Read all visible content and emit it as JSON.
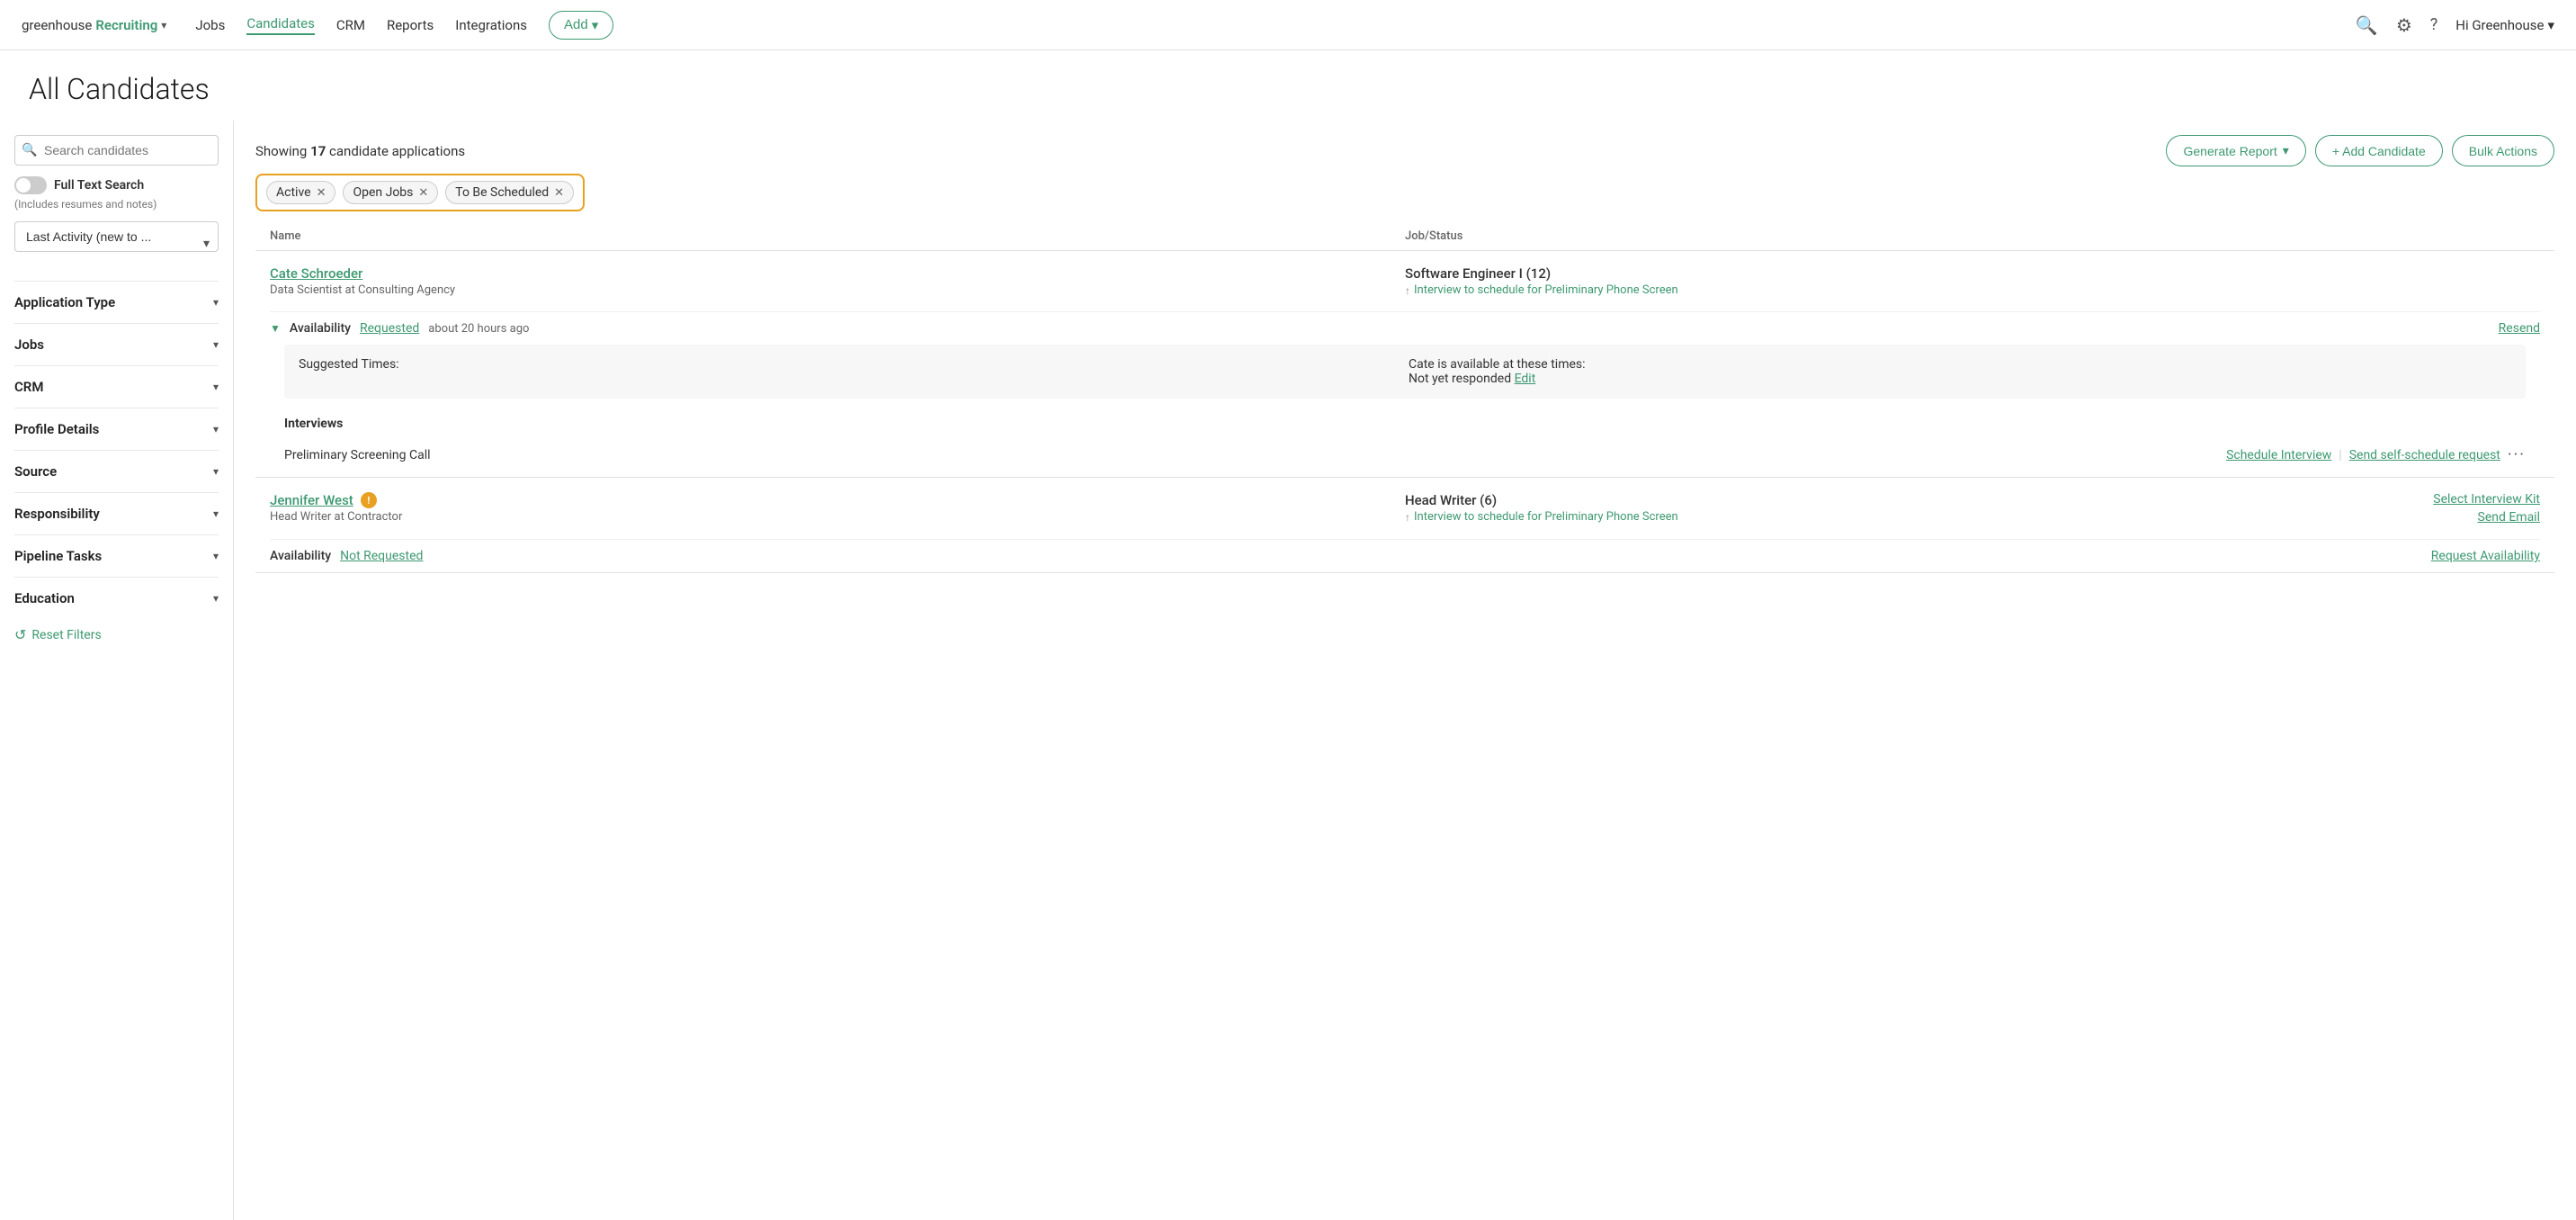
{
  "nav": {
    "logo_text": "greenhouse",
    "logo_green": "Recruiting",
    "links": [
      "Jobs",
      "Candidates",
      "CRM",
      "Reports",
      "Integrations"
    ],
    "active_link": "Candidates",
    "add_button": "Add",
    "user_text": "Hi Greenhouse"
  },
  "page": {
    "title": "All Candidates"
  },
  "sidebar": {
    "search_placeholder": "Search candidates",
    "full_text_label": "Full Text Search",
    "full_text_sub": "(Includes resumes and notes)",
    "sort_option": "Last Activity (new to ...",
    "filters": [
      {
        "id": "application-type",
        "label": "Application Type"
      },
      {
        "id": "jobs",
        "label": "Jobs"
      },
      {
        "id": "crm",
        "label": "CRM"
      },
      {
        "id": "profile-details",
        "label": "Profile Details"
      },
      {
        "id": "source",
        "label": "Source"
      },
      {
        "id": "responsibility",
        "label": "Responsibility"
      },
      {
        "id": "pipeline-tasks",
        "label": "Pipeline Tasks"
      },
      {
        "id": "education",
        "label": "Education"
      }
    ],
    "reset_filters": "Reset Filters"
  },
  "content": {
    "showing_label": "Showing",
    "showing_count": "17",
    "showing_suffix": "candidate applications",
    "generate_report": "Generate Report",
    "add_candidate": "+ Add Candidate",
    "bulk_actions": "Bulk Actions"
  },
  "filter_tags": [
    {
      "label": "Active",
      "id": "active"
    },
    {
      "label": "Open Jobs",
      "id": "open-jobs"
    },
    {
      "label": "To Be Scheduled",
      "id": "to-be-scheduled"
    }
  ],
  "table": {
    "col_name": "Name",
    "col_job_status": "Job/Status"
  },
  "candidates": [
    {
      "id": "cate-schroeder",
      "name": "Cate Schroeder",
      "subtitle": "Data Scientist at Consulting Agency",
      "job_title": "Software Engineer I (12)",
      "job_status": "Interview to schedule for Preliminary Phone Screen",
      "has_warning": false,
      "availability": {
        "label": "Availability",
        "status": "Requested",
        "time_ago": "about 20 hours ago",
        "resend": "Resend",
        "suggested_times_label": "Suggested Times:",
        "suggested_value_line1": "Cate is available at these times:",
        "suggested_value_line2": "Not yet responded",
        "edit_link": "Edit"
      },
      "interviews_title": "Interviews",
      "interviews": [
        {
          "name": "Preliminary Screening Call",
          "action1": "Schedule Interview",
          "sep": "|",
          "action2": "Send self-schedule request",
          "more": "···"
        }
      ],
      "right_actions": []
    },
    {
      "id": "jennifer-west",
      "name": "Jennifer West",
      "subtitle": "Head Writer at Contractor",
      "job_title": "Head Writer (6)",
      "job_status": "Interview to schedule for Preliminary Phone Screen",
      "has_warning": true,
      "availability": {
        "label": "Availability",
        "status": "Not Requested",
        "status_plain": true,
        "request_btn": "Request Availability"
      },
      "right_actions": [
        {
          "label": "Select Interview Kit"
        },
        {
          "label": "Send Email"
        }
      ]
    }
  ]
}
